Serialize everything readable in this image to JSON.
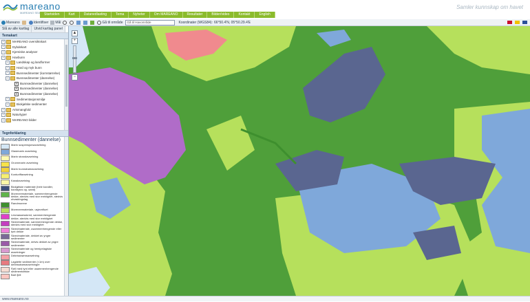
{
  "header": {
    "logo_text": "mareano",
    "logo_sub": "MAREANO SEABED MAPPING",
    "tagline": "Samler kunnskap om havet",
    "menu": [
      "Startsiden",
      "Kart",
      "Datanedlasting",
      "Tema",
      "Nyheter",
      "Om MAREANO",
      "Resultater",
      "Bilder/video",
      "Kontakt",
      "English"
    ]
  },
  "toolbar": {
    "app_label": "Mareano",
    "identify_label": "Identifiser",
    "measure_label": "Mål",
    "goto_label": "Gå til område",
    "goto_placeholder": "Gå til Havområde",
    "coords_label": "Koordinater (WGS84):",
    "coords_value": "66°50.4'N, 05°50.29.4'E"
  },
  "left": {
    "tabs": [
      "Slå av alle kartlag",
      "Utvid kartlag panel"
    ],
    "tree_title": "Temakart",
    "tree": [
      {
        "label": "MAREANO oversiktskart",
        "level": 0,
        "type": "folder"
      },
      {
        "label": "Dybdekart",
        "level": 0,
        "type": "folder"
      },
      {
        "label": "Kjemiske analyser",
        "level": 0,
        "type": "folder"
      },
      {
        "label": "Havbunn",
        "level": 0,
        "type": "folder"
      },
      {
        "label": "Landskap og landformer",
        "level": 1,
        "type": "folder"
      },
      {
        "label": "Hard og myk bunn",
        "level": 1,
        "type": "folder"
      },
      {
        "label": "Bunnsedimenter (kornstørrelse)",
        "level": 1,
        "type": "folder"
      },
      {
        "label": "Bunnsedimenter (dannelse)",
        "level": 1,
        "type": "folder"
      },
      {
        "label": "Bunnsedimenter (dannelse)",
        "level": 2,
        "type": "check"
      },
      {
        "label": "Bunnsedimenter (dannelse)",
        "level": 2,
        "type": "check"
      },
      {
        "label": "Bunnsedimenter (dannelse)",
        "level": 2,
        "type": "check"
      },
      {
        "label": "Sedimentasjonsmiljø",
        "level": 1,
        "type": "folder"
      },
      {
        "label": "Biokjølske sedimenter",
        "level": 1,
        "type": "folder"
      },
      {
        "label": "Artsmangfold",
        "level": 0,
        "type": "folder"
      },
      {
        "label": "Naturtyper",
        "level": 0,
        "type": "folder"
      },
      {
        "label": "MAREANO bilder",
        "level": 0,
        "type": "folder"
      }
    ],
    "legend_title": "Tegnforklaring",
    "legend_heading": "Bunnsedimenter (dannelse)",
    "legend": [
      {
        "label": "Marin suspensjonsavsetning",
        "color": "#d4e7f6"
      },
      {
        "label": "Glasimarin avsetning",
        "color": "#7fa8da"
      },
      {
        "label": "Marin strandavsetning",
        "color": "#fff9b0"
      },
      {
        "label": "Grunnmarin avsetning",
        "color": "#f7e24a"
      },
      {
        "label": "Marin bunnstrømavsetning",
        "color": "#f2d23c"
      },
      {
        "label": "Konturiffavsetning",
        "color": "#f6ef72"
      },
      {
        "label": "Kanalavsetning",
        "color": "#fbf6a8"
      },
      {
        "label": "Biokjølske materiale (hele koraller, koraligrus og -sand)",
        "color": "#3d4f7a"
      },
      {
        "label": "Moreneemateriale, sammenhengende dekke, stedvis med stor mektighet, stedvis utvaskingslag",
        "color": "#5fb34a"
      },
      {
        "label": "Randmorene",
        "color": "#3e8f2e"
      },
      {
        "label": "Moreneemateriale, usjevnfluet",
        "color": "#b6e05c"
      },
      {
        "label": "Lesmassesskred, sammenhengende dekke, stedvis med stor mektighet",
        "color": "#e040c8"
      },
      {
        "label": "Skredmateriale, sammenhengende dekke, stedvis med stor mektighet",
        "color": "#c43fc0"
      },
      {
        "label": "Skredmateriale, usammenhengende eller tynt dekke",
        "color": "#f080d8"
      },
      {
        "label": "Skredmateriale, dekket av yngre sedimenter",
        "color": "#7a6a96"
      },
      {
        "label": "Skredmateriale, delvis dekket av yngre sedimenter",
        "color": "#9a5aa8"
      },
      {
        "label": "Skredmateriale og hemipelagiske avsetninger",
        "color": "#d89ad0"
      },
      {
        "label": "Debrisstrømsavsetning",
        "color": "#f4a0a6"
      },
      {
        "label": "Lagdelte sedimenter (<1m) over debrisstrømavsetninger",
        "color": "#e77a7f"
      },
      {
        "label": "Fjell med tynt eller usammenhengende sedimentdekke",
        "color": "#f6dcd2"
      },
      {
        "label": "Bart fjell",
        "color": "#fbc6c0"
      }
    ]
  },
  "footer": {
    "text": "www.mareano.no"
  },
  "colors": {
    "menu_green": "#8bbb2c",
    "map_mid_green": "#4f9f3a",
    "map_light_green": "#b6e05c",
    "map_blue": "#7fa8da",
    "map_slate": "#5a6690",
    "map_purple": "#b06cc8",
    "map_pink": "#f08a8e"
  }
}
